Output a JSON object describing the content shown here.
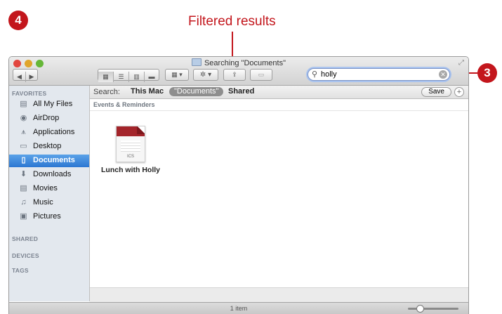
{
  "callouts": {
    "step_4": "4",
    "step_3": "3",
    "filtered_label": "Filtered results"
  },
  "window": {
    "title": "Searching \"Documents\"",
    "traffic_colors": [
      "#e2463f",
      "#e0a52c",
      "#66b738"
    ]
  },
  "toolbar": {
    "back_icon": "back-arrow-icon",
    "forward_icon": "forward-arrow-icon",
    "view_icons": [
      "icon-view-icon",
      "list-view-icon",
      "column-view-icon",
      "cover-flow-icon"
    ],
    "arrange_icon": "arrange-icon",
    "action_icon": "gear-icon",
    "share_icon": "share-icon",
    "tag_icon": "tag-icon"
  },
  "search": {
    "value": "holly",
    "icon": "search-icon"
  },
  "sidebar": {
    "favorites_label": "FAVORITES",
    "items": [
      {
        "label": "All My Files",
        "icon": "all-files-icon"
      },
      {
        "label": "AirDrop",
        "icon": "airdrop-icon"
      },
      {
        "label": "Applications",
        "icon": "applications-icon"
      },
      {
        "label": "Desktop",
        "icon": "desktop-icon"
      },
      {
        "label": "Documents",
        "icon": "documents-icon"
      },
      {
        "label": "Downloads",
        "icon": "downloads-icon"
      },
      {
        "label": "Movies",
        "icon": "movies-icon"
      },
      {
        "label": "Music",
        "icon": "music-icon"
      },
      {
        "label": "Pictures",
        "icon": "pictures-icon"
      }
    ],
    "selected": "Documents",
    "shared_label": "SHARED",
    "devices_label": "DEVICES",
    "tags_label": "TAGS"
  },
  "scope": {
    "label": "Search:",
    "options": [
      "This Mac",
      "\"Documents\"",
      "Shared"
    ],
    "selected": "\"Documents\"",
    "save_label": "Save",
    "add_label": "+"
  },
  "results": {
    "group_title": "Events & Reminders",
    "files": [
      {
        "name": "Lunch with Holly",
        "ext": "ICS"
      }
    ]
  },
  "status": {
    "text": "1 item"
  },
  "colors": {
    "callout_red": "#c3161c",
    "selection_blue": "#2c77d2"
  }
}
